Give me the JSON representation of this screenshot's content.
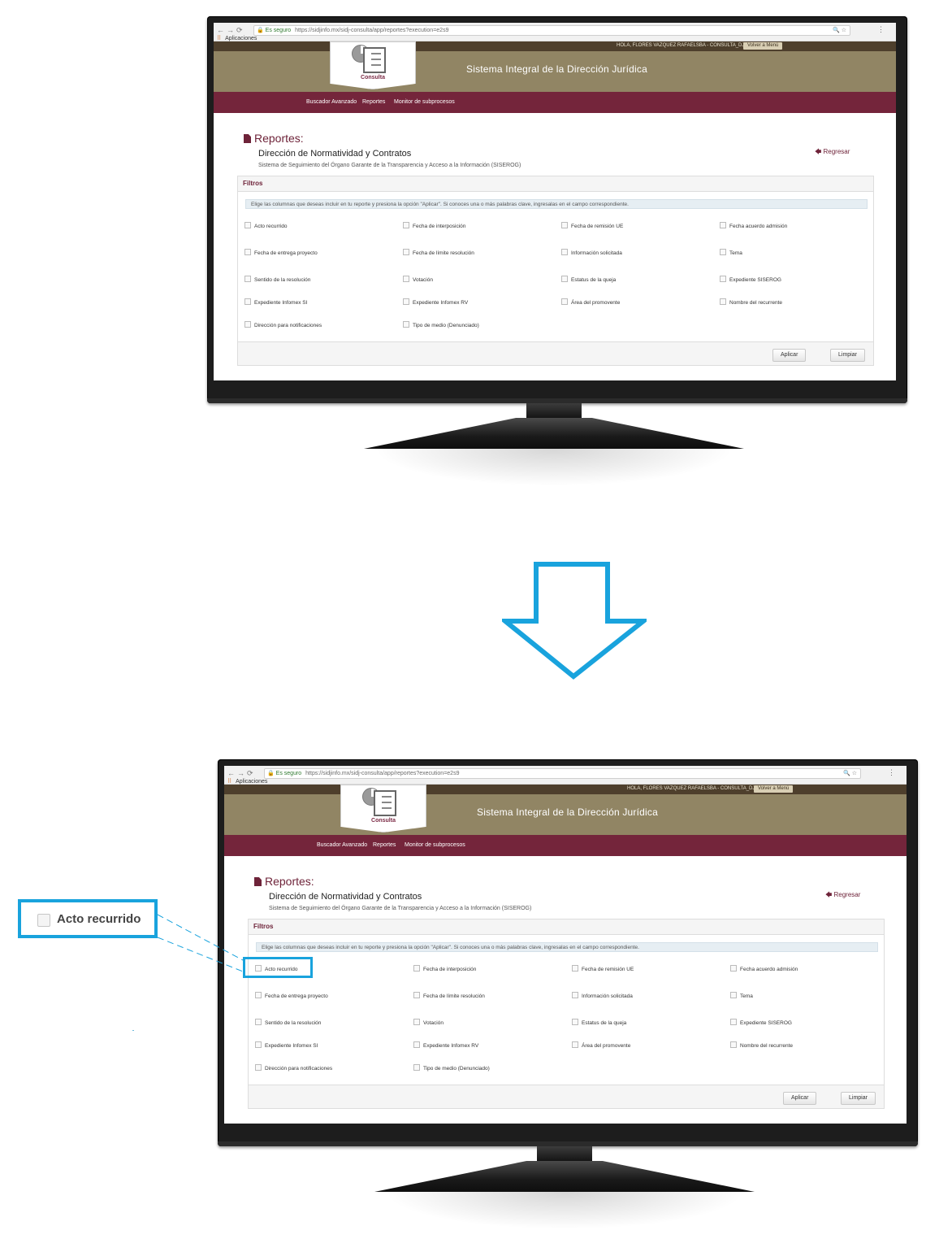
{
  "browser": {
    "nav_icons": [
      "arrow-left-icon",
      "arrow-right-icon",
      "reload-icon"
    ],
    "secure_label": "Es seguro",
    "url": "https://sidjinfo.mx/sidj-consulta/app/reportes?execution=e2s9",
    "bookmarks_label": "Aplicaciones"
  },
  "header": {
    "user_info": "HOLA, FLORES VAZQUEZ RAFAELSBA - CONSULTA_DJ",
    "back_button": "Volver a Menú",
    "logo_caption": "Consulta",
    "system_title": "Sistema Integral de la Dirección Jurídica"
  },
  "menu": {
    "items": [
      {
        "label": "Buscador Avanzado"
      },
      {
        "label": "Reportes"
      },
      {
        "label": "Monitor de subprocesos"
      }
    ]
  },
  "page": {
    "title": "Reportes:",
    "subtitle": "Dirección de Normatividad y Contratos",
    "system_desc": "Sistema de Seguimiento del Órgano Garante de la Transparencia y Acceso a la Información (SISEROG)",
    "back_link": "Regresar"
  },
  "filters": {
    "heading": "Filtros",
    "info": "Elige las columnas que deseas incluir en tu reporte y presiona la opción \"Aplicar\". Si conoces una o más palabras clave, ingresalas en el campo correspondiente.",
    "options": [
      "Acto recurrido",
      "Fecha de interposición",
      "Fecha de remisión UE",
      "Fecha acuerdo admisión",
      "Fecha de entrega proyecto",
      "Fecha de límite resolución",
      "Información solicitada",
      "Tema",
      "Sentido de la resolución",
      "Votación",
      "Estatus de la queja",
      "Expediente SISEROG",
      "Expediente Infomex SI",
      "Expediente Infomex RV",
      "Área del promovente",
      "Nombre del recurrente",
      "Dirección para notificaciones",
      "Tipo de medio (Denunciado)"
    ],
    "apply_label": "Aplicar",
    "clear_label": "Limpiar"
  },
  "callout": {
    "label": "Acto recurrido",
    "arrow_color": "#19a3dd"
  },
  "colors": {
    "wine": "#74253b",
    "olive": "#918564",
    "dark_brown": "#4e3f2c",
    "accent_blue": "#19a3dd"
  }
}
